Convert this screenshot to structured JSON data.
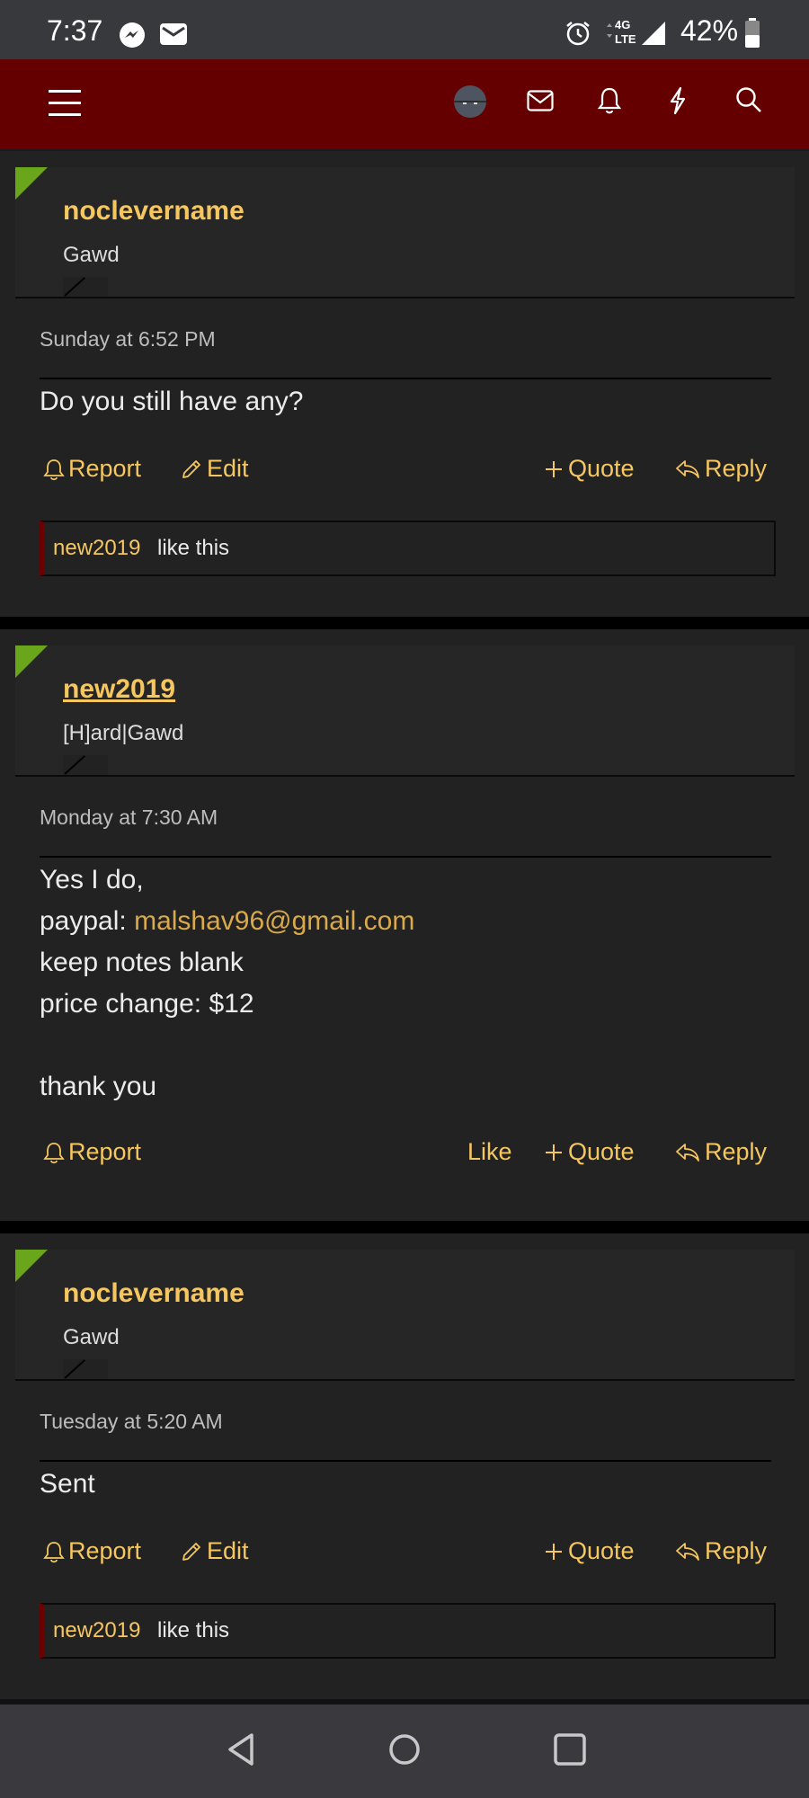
{
  "status_bar": {
    "time": "7:37",
    "network": "4G LTE",
    "battery": "42%"
  },
  "header": {
    "menu_icon": "hamburger-icon",
    "icons": [
      "avatar",
      "envelope-icon",
      "bell-icon",
      "lightning-icon",
      "search-icon"
    ]
  },
  "colors": {
    "header_bg": "#640000",
    "accent": "#f6c75f",
    "link": "#d9a94a",
    "post_bg": "#222222",
    "corner": "#6aa61c"
  },
  "posts": [
    {
      "username": "noclevername",
      "user_title": "Gawd",
      "date": "Sunday at 6:52 PM",
      "body": "Do you still have any?",
      "actions": {
        "report": "Report",
        "edit": "Edit",
        "quote": "Quote",
        "reply": "Reply"
      },
      "likes": {
        "user": "new2019",
        "text": "like this"
      }
    },
    {
      "username": "new2019",
      "user_title": "[H]ard|Gawd",
      "date": "Monday at 7:30 AM",
      "body_lines": {
        "l1": "Yes I do,",
        "l2_label": "paypal: ",
        "l2_link": "malshav96@gmail.com",
        "l3": "keep notes blank",
        "l4": "price change: $12",
        "l5": "thank you"
      },
      "actions": {
        "report": "Report",
        "like": "Like",
        "quote": "Quote",
        "reply": "Reply"
      }
    },
    {
      "username": "noclevername",
      "user_title": "Gawd",
      "date": "Tuesday at 5:20 AM",
      "body": "Sent",
      "actions": {
        "report": "Report",
        "edit": "Edit",
        "quote": "Quote",
        "reply": "Reply"
      },
      "likes": {
        "user": "new2019",
        "text": "like this"
      }
    }
  ],
  "nav_bar": {
    "icons": [
      "back-icon",
      "home-icon",
      "recents-icon"
    ]
  }
}
